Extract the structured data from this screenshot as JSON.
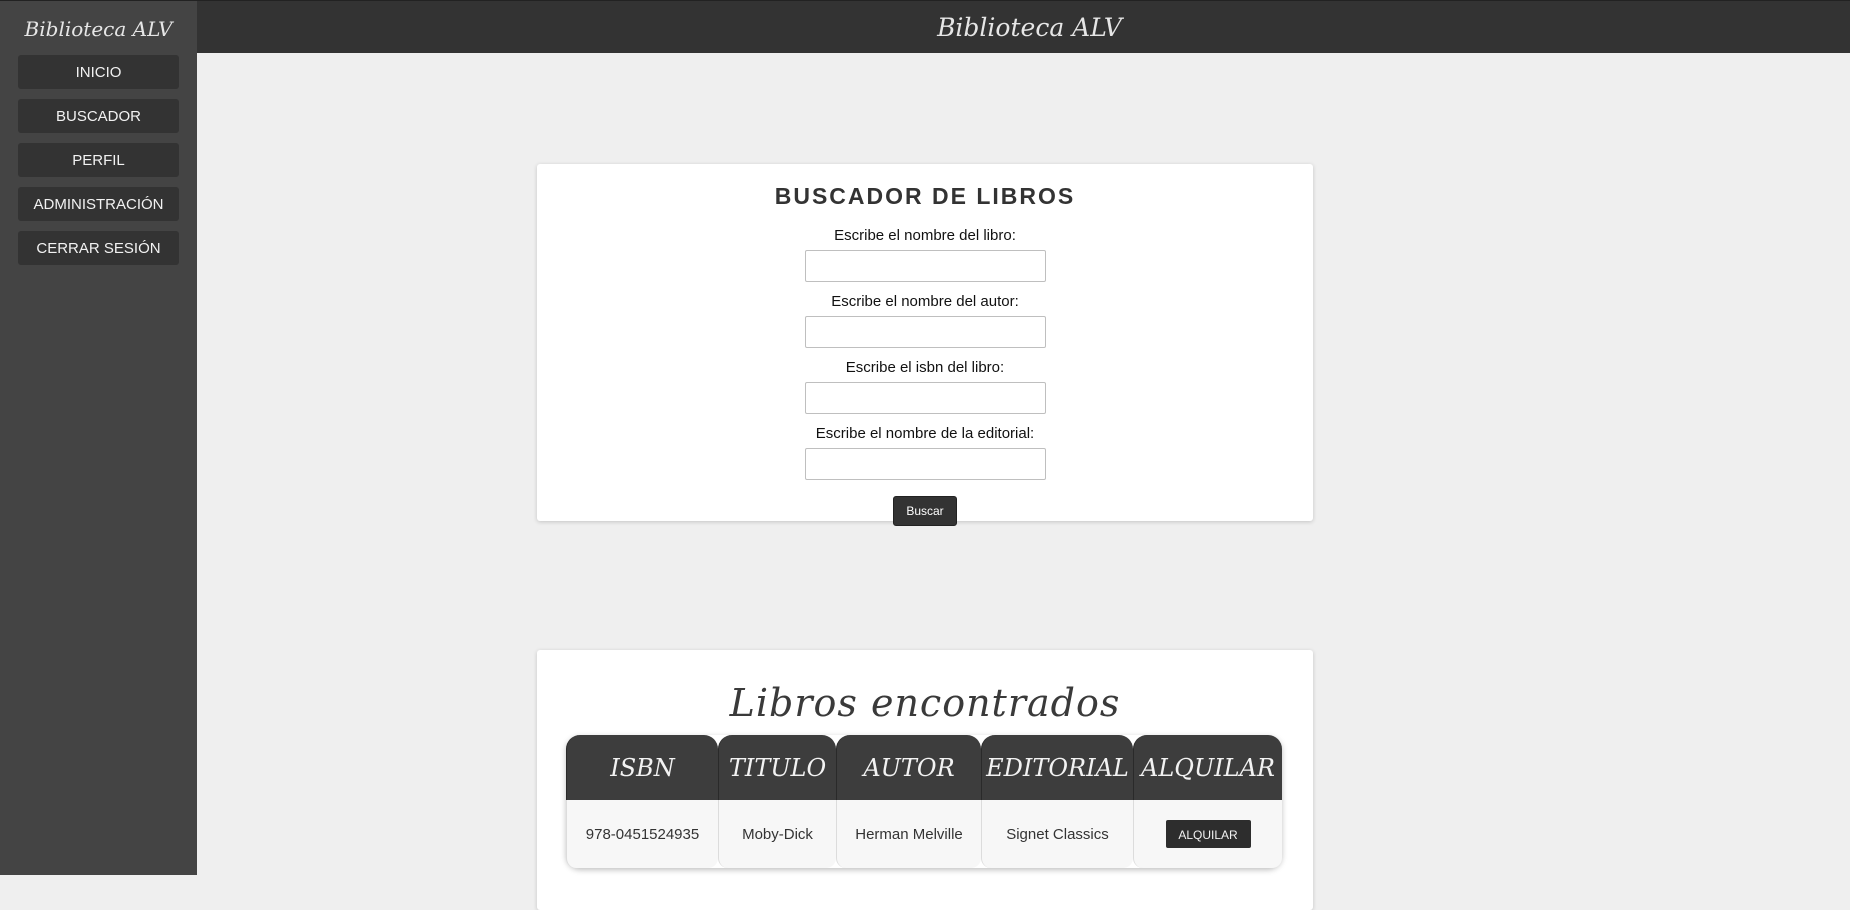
{
  "app": {
    "brand": "Biblioteca ALV",
    "header_title": "Biblioteca ALV"
  },
  "sidebar": {
    "items": [
      {
        "label": "INICIO"
      },
      {
        "label": "BUSCADOR"
      },
      {
        "label": "PERFIL"
      },
      {
        "label": "ADMINISTRACIÓN"
      },
      {
        "label": "CERRAR SESIÓN"
      }
    ]
  },
  "search": {
    "title": "BUSCADOR DE LIBROS",
    "fields": [
      {
        "label": "Escribe el nombre del libro:",
        "value": ""
      },
      {
        "label": "Escribe el nombre del autor:",
        "value": ""
      },
      {
        "label": "Escribe el isbn del libro:",
        "value": ""
      },
      {
        "label": "Escribe el nombre de la editorial:",
        "value": ""
      }
    ],
    "submit_label": "Buscar"
  },
  "results": {
    "title": "Libros encontrados",
    "columns": [
      "ISBN",
      "TITULO",
      "AUTOR",
      "EDITORIAL",
      "ALQUILAR"
    ],
    "rows": [
      {
        "isbn": "978-0451524935",
        "titulo": "Moby-Dick",
        "autor": "Herman Melville",
        "editorial": "Signet Classics",
        "action_label": "ALQUILAR"
      }
    ]
  },
  "colors": {
    "sidebar_bg": "#444444",
    "topbar_bg": "#333333",
    "page_bg": "#efefef",
    "button_bg": "#333333"
  }
}
